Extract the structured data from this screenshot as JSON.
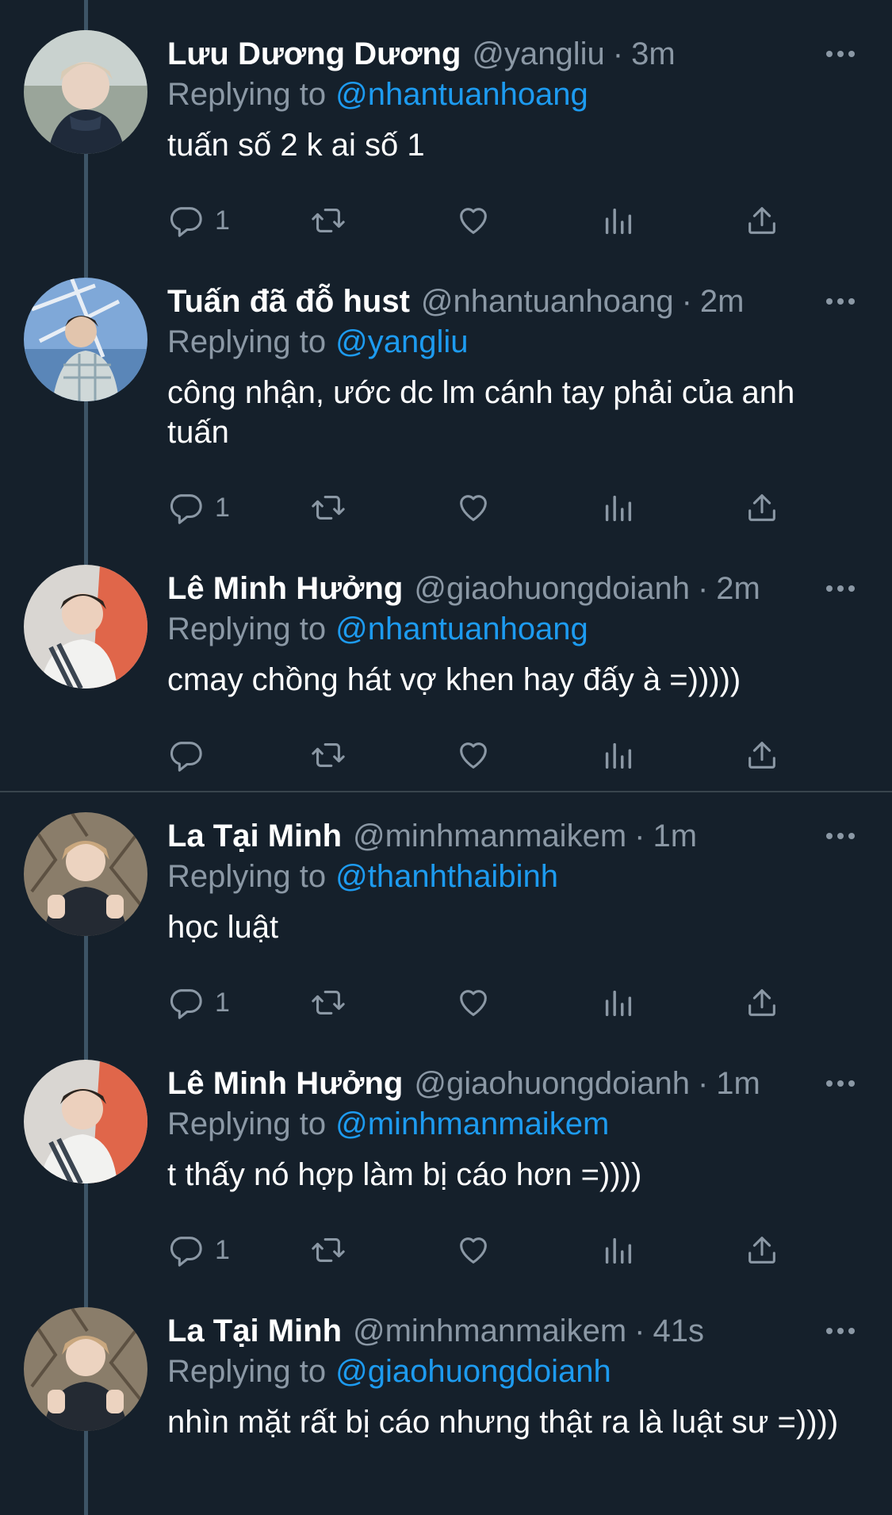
{
  "colors": {
    "background": "#15202b",
    "accent": "#1d9bf0",
    "muted": "#8b98a5",
    "thread_line": "#3d5466"
  },
  "icons": {
    "more": "more-horizontal-icon",
    "reply": "reply-icon",
    "retweet": "retweet-icon",
    "like": "heart-icon",
    "analytics": "analytics-icon",
    "share": "share-icon"
  },
  "tweets": [
    {
      "name": "Lưu Dương Dương",
      "handle": "@yangliu",
      "dot": "·",
      "time": "3m",
      "replying_label": "Replying to",
      "replying_to": "@nhantuanhoang",
      "text": "tuấn số 2 k ai số 1",
      "reply_count": "1"
    },
    {
      "name": "Tuấn đã đỗ hust",
      "handle": "@nhantuanhoang",
      "dot": "·",
      "time": "2m",
      "replying_label": "Replying to",
      "replying_to": "@yangliu",
      "text": "công nhận, ước dc lm cánh tay phải của anh tuấn",
      "reply_count": "1"
    },
    {
      "name": "Lê Minh Hưởng",
      "handle": "@giaohuongdoianh",
      "dot": "·",
      "time": "2m",
      "replying_label": "Replying to",
      "replying_to": "@nhantuanhoang",
      "text": "cmay chồng hát vợ khen hay đấy à =)))))",
      "reply_count": ""
    },
    {
      "name": "La Tại Minh",
      "handle": "@minhmanmaikem",
      "dot": "·",
      "time": "1m",
      "replying_label": "Replying to",
      "replying_to": "@thanhthaibinh",
      "text": "học luật",
      "reply_count": "1"
    },
    {
      "name": "Lê Minh Hưởng",
      "handle": "@giaohuongdoianh",
      "dot": "·",
      "time": "1m",
      "replying_label": "Replying to",
      "replying_to": "@minhmanmaikem",
      "text": "t thấy nó hợp làm bị cáo hơn =))))",
      "reply_count": "1"
    },
    {
      "name": "La Tại Minh",
      "handle": "@minhmanmaikem",
      "dot": "·",
      "time": "41s",
      "replying_label": "Replying to",
      "replying_to": "@giaohuongdoianh",
      "text": "nhìn mặt rất bị cáo nhưng thật ra là luật sư =))))",
      "reply_count": ""
    }
  ]
}
